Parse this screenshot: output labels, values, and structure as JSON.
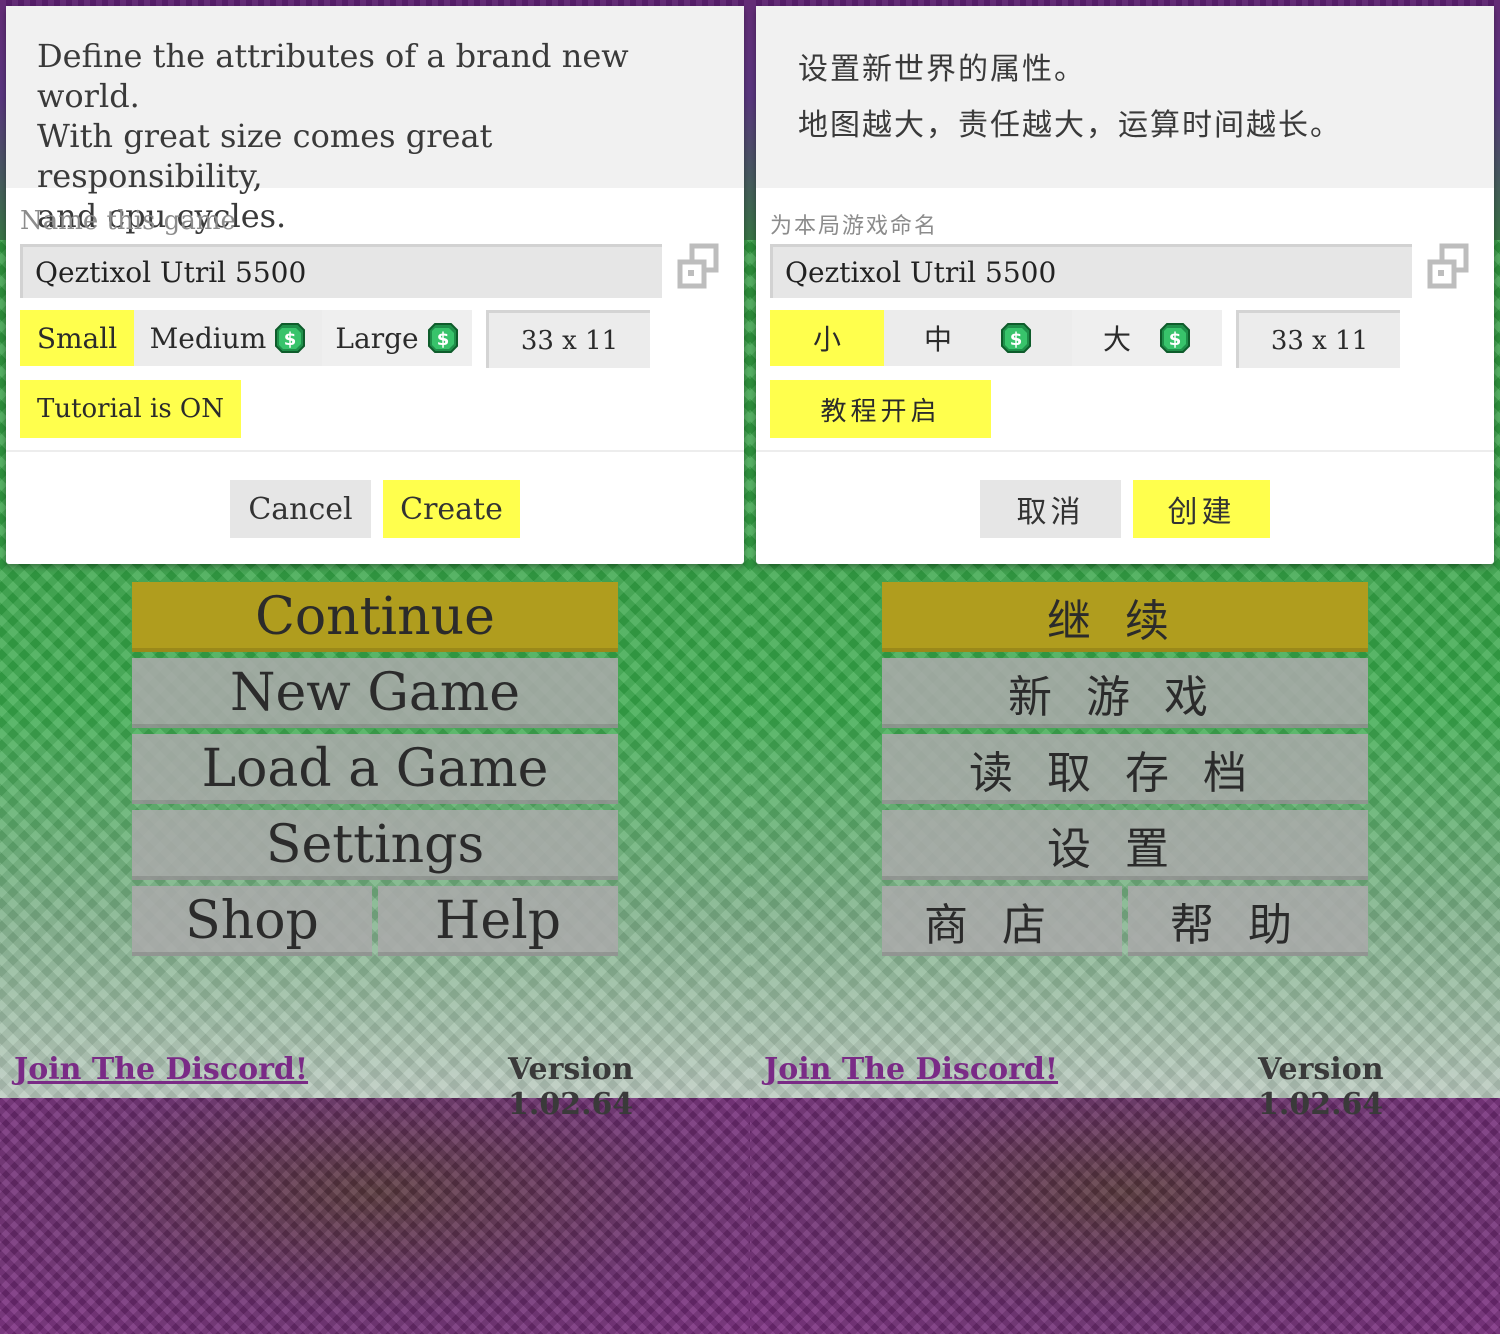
{
  "colors": {
    "accent_yellow": "#ffff4d",
    "continue_gold": "#b09d1e",
    "discord_purple": "#7a2b86"
  },
  "left": {
    "dialog": {
      "description": "Define the attributes of a brand new world.\nWith great size comes great responsibility,\nand cpu cycles.",
      "name_label": "Name this game",
      "name_value": "Qeztixol Utril 5500",
      "sizes": [
        "Small",
        "Medium",
        "Large"
      ],
      "selected_size": "Small",
      "dimensions": "33 x 11",
      "tutorial_label": "Tutorial is ON",
      "cancel_label": "Cancel",
      "create_label": "Create"
    },
    "menu": {
      "continue": "Continue",
      "new_game": "New Game",
      "load_game": "Load a Game",
      "settings": "Settings",
      "shop": "Shop",
      "help": "Help"
    },
    "footer": {
      "discord": "Join The Discord!",
      "version": "Version 1.02.64"
    }
  },
  "right": {
    "dialog": {
      "description": "设置新世界的属性。\n地图越大，责任越大，运算时间越长。",
      "name_label": "为本局游戏命名",
      "name_value": "Qeztixol Utril 5500",
      "sizes": [
        "小",
        "中",
        "大"
      ],
      "selected_size": "小",
      "dimensions": "33 x 11",
      "tutorial_label": "教程开启",
      "cancel_label": "取消",
      "create_label": "创建"
    },
    "menu": {
      "continue": "继续",
      "new_game": "新游戏",
      "load_game": "读取存档",
      "settings": "设置",
      "shop": "商店",
      "help": "帮助"
    },
    "footer": {
      "discord": "Join The Discord!",
      "version": "Version 1.02.64"
    }
  },
  "icons": {
    "randomize": "dice-icon",
    "premium": "coin-dollar-icon"
  }
}
